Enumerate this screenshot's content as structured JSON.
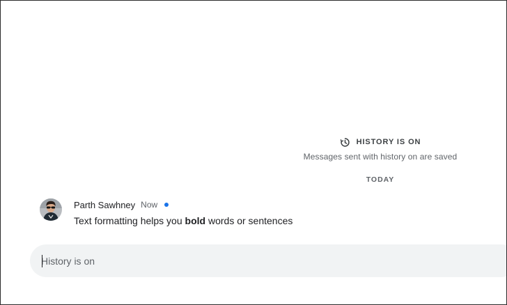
{
  "history": {
    "title": "HISTORY IS ON",
    "subtitle": "Messages sent with history on are saved",
    "icon": "history-icon"
  },
  "day_divider": "TODAY",
  "message": {
    "sender": "Parth Sawhney",
    "time": "Now",
    "text_before": "Text formatting helps you ",
    "text_bold": "bold",
    "text_after": " words or sentences",
    "unread_color": "#1a73e8"
  },
  "compose": {
    "placeholder": "History is on"
  }
}
